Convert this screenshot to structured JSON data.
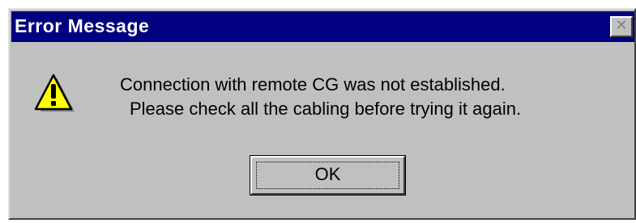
{
  "dialog": {
    "title": "Error Message",
    "close_icon": "close-icon",
    "icon": "warning-icon",
    "message_line1": "Connection with remote CG was not established.",
    "message_line2": "Please check all the cabling before trying it again.",
    "ok_label": "OK"
  },
  "colors": {
    "title_bar": "#000080",
    "dialog_face": "#c0c0c0",
    "warning_yellow": "#ffff00"
  }
}
